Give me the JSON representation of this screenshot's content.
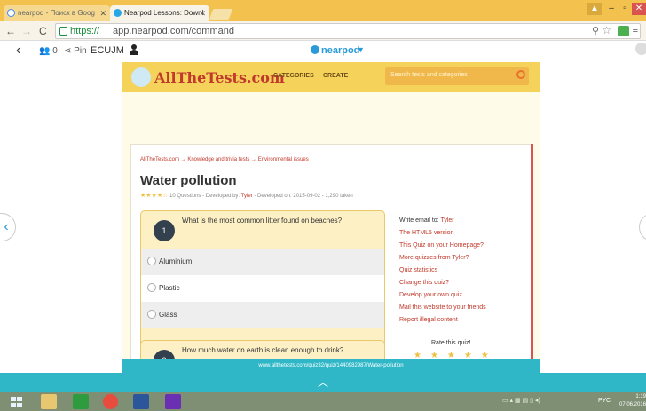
{
  "browser": {
    "tabs": [
      {
        "label": "nearpod - Поиск в Goog"
      },
      {
        "label": "Nearpod Lessons: Downl"
      }
    ],
    "url_scheme": "https://",
    "url_rest": "app.nearpod.com/command"
  },
  "nearpod": {
    "student_count": "0",
    "pin_label": "Pin",
    "code": "ECUJM",
    "logo": "nearpod"
  },
  "site": {
    "logo": "AllTheTests.com",
    "nav": [
      "CATEGORIES",
      "CREATE"
    ],
    "search_placeholder": "Search tests and categories",
    "breadcrumb": "AllTheTests.com → Knowledge and trivia tests → Environmental issues",
    "title": "Water pollution",
    "meta_stars": "★★★★☆",
    "meta_text": " 10 Questions - Developed by: ",
    "meta_author": "Tyler",
    "meta_rest": " - Developed on: 2015-09-02 - 1,290 taken",
    "questions": [
      {
        "number": "1",
        "text": "What is the most common litter found on beaches?",
        "options": [
          "Aluminium",
          "Plastic",
          "Glass"
        ]
      },
      {
        "number": "2",
        "text": "How much water on earth is clean enough to drink?"
      }
    ],
    "sidebar": {
      "write_email_label": "Write email to: ",
      "write_email_author": "Tyler",
      "links": [
        "The HTML5 version",
        "This Quiz on your Homepage?",
        "More quizzes from Tyler?",
        "Quiz statistics",
        "Change this quiz?",
        "Develop your own quiz",
        "Mail this website to your friends",
        "Report illegal content"
      ],
      "rate_label": "Rate this quiz!",
      "rate_stars": "★★★★★"
    }
  },
  "bottom": {
    "url_banner": "www.allthetests.com/quiz32/quiz/1440982987/Water-pollution"
  },
  "taskbar": {
    "lang": "РУС",
    "time": "1:19",
    "date": "07.06.2016"
  },
  "colors": {
    "accent": "#2fb7c7",
    "site_header": "#f5d25a",
    "link": "#c0392b"
  }
}
